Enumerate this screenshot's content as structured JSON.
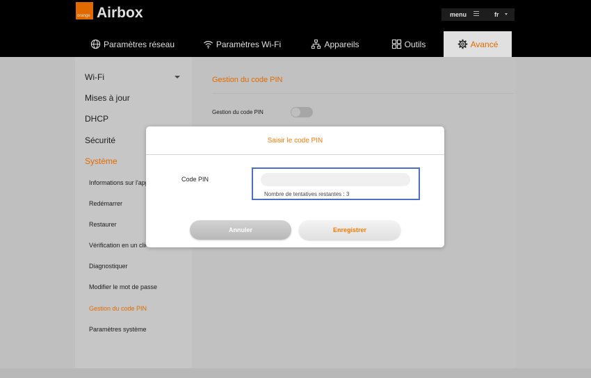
{
  "header": {
    "logo_text": "orange",
    "brand": "Airbox",
    "menu_label": "menu",
    "language": "fr",
    "brand_color": "#ff7900"
  },
  "tabs": [
    {
      "label": "Paramètres réseau",
      "icon": "globe-icon",
      "active": false
    },
    {
      "label": "Paramètres Wi-Fi",
      "icon": "wifi-icon",
      "active": false
    },
    {
      "label": "Appareils",
      "icon": "network-icon",
      "active": false
    },
    {
      "label": "Outils",
      "icon": "grid-icon",
      "active": false
    },
    {
      "label": "Avancé",
      "icon": "gear-icon",
      "active": true
    }
  ],
  "sidebar": {
    "items": [
      {
        "label": "Wi-Fi"
      },
      {
        "label": "Mises à jour"
      },
      {
        "label": "DHCP"
      },
      {
        "label": "Sécurité"
      },
      {
        "label": "Système",
        "active": true
      }
    ],
    "subitems": [
      {
        "label": "Informations sur l'appareil"
      },
      {
        "label": "Redémarrer"
      },
      {
        "label": "Restaurer"
      },
      {
        "label": "Vérification en un clic"
      },
      {
        "label": "Diagnostiquer"
      },
      {
        "label": "Modifier le mot de passe"
      },
      {
        "label": "Gestion du code PIN",
        "active": true
      },
      {
        "label": "Paramètres système"
      }
    ]
  },
  "main": {
    "section_title": "Gestion du code PIN",
    "pin_toggle_label": "Gestion du code PIN",
    "pin_toggle_on": false
  },
  "modal": {
    "title": "Saisir le code PIN",
    "field_label": "Code PIN",
    "field_value": "",
    "attempts_text": "Nombre de tentatives restantes :  3",
    "cancel_label": "Annuler",
    "save_label": "Enregistrer"
  }
}
